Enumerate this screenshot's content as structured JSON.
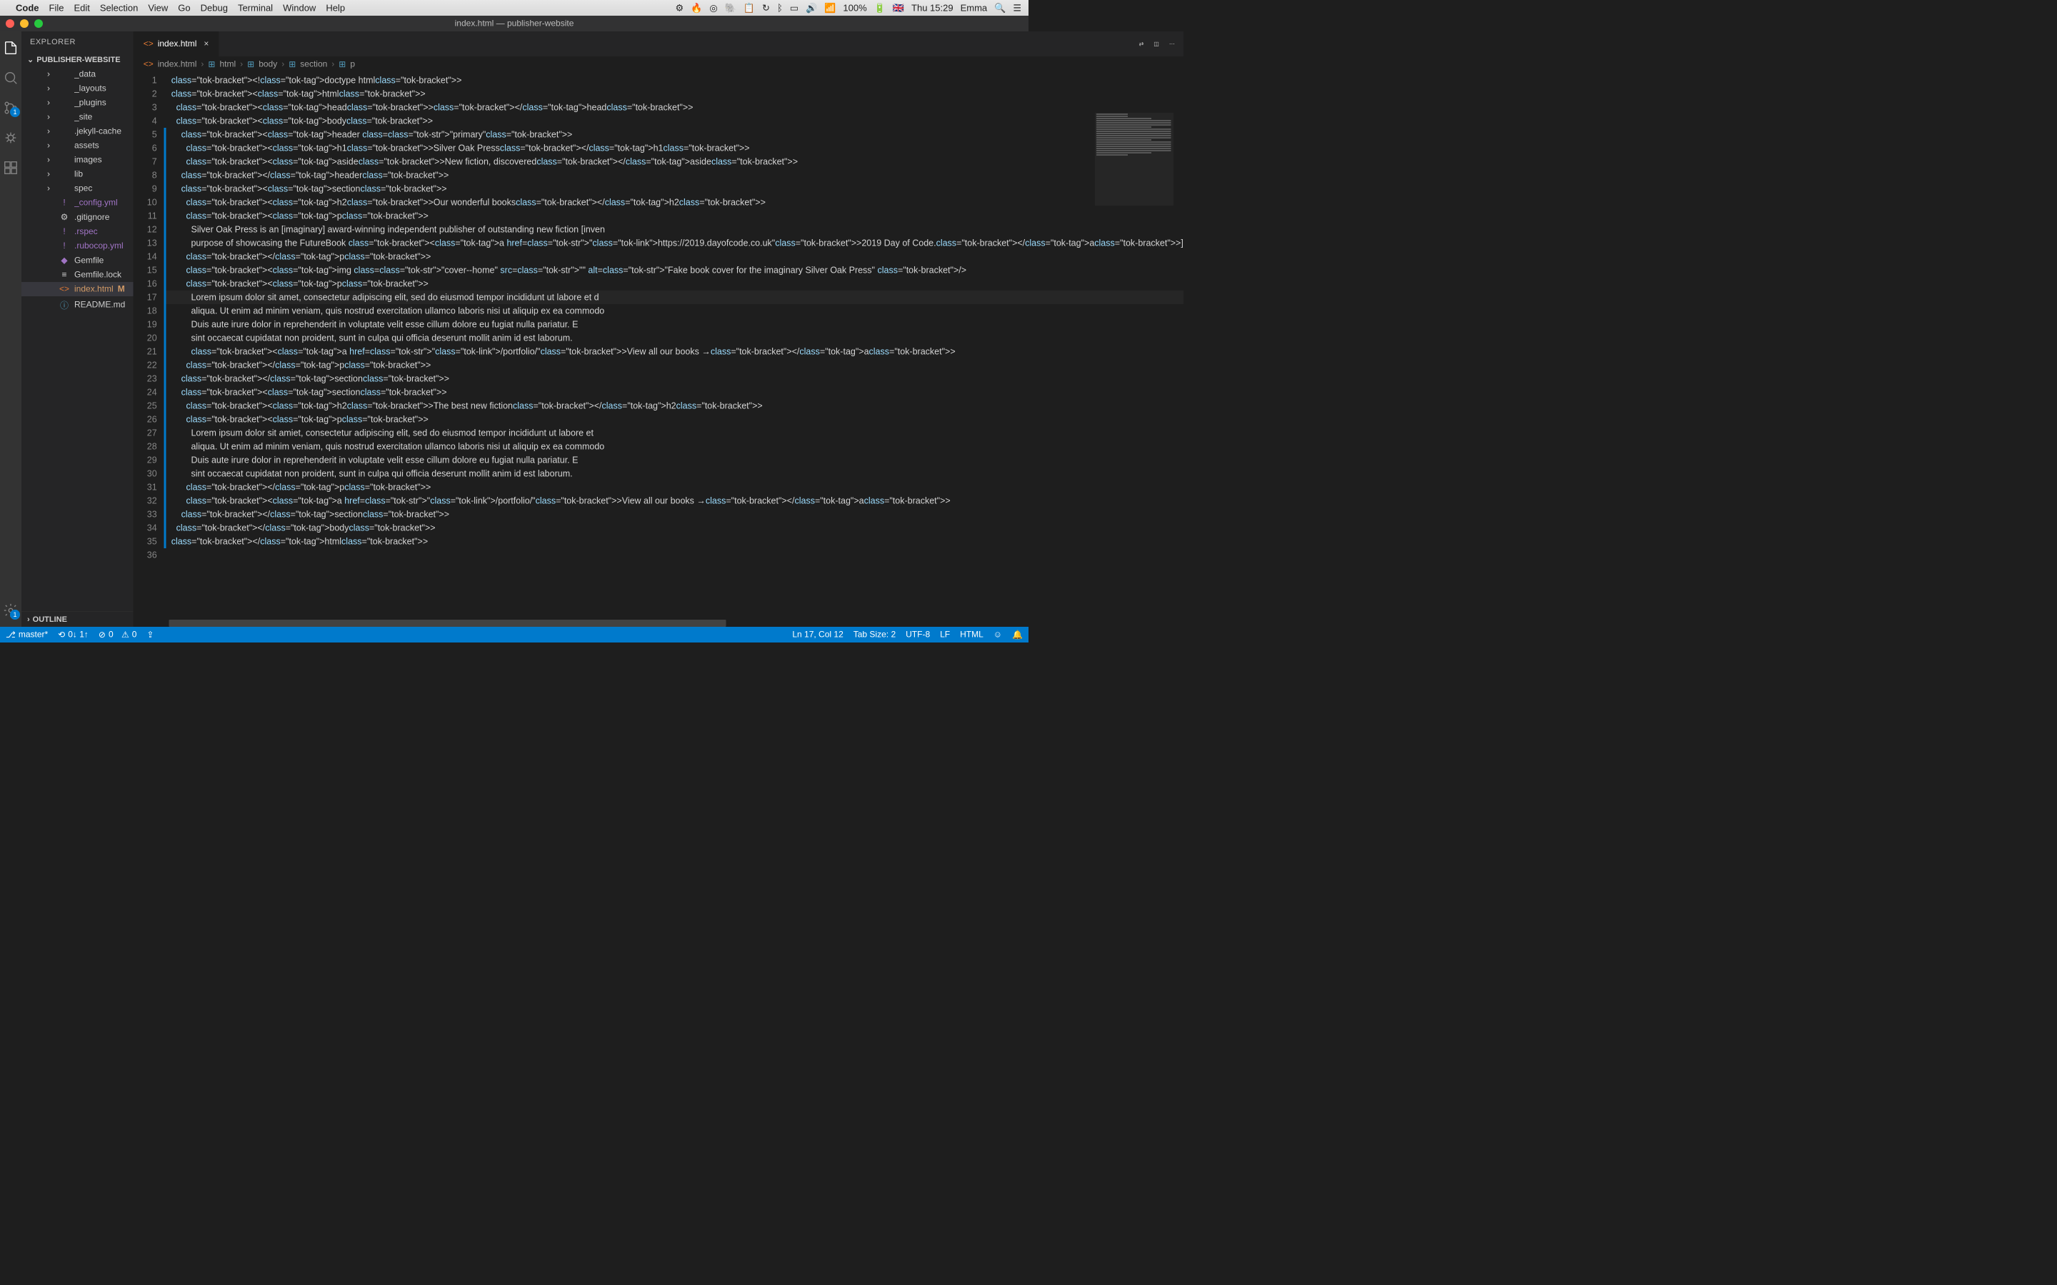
{
  "menubar": {
    "app": "Code",
    "items": [
      "File",
      "Edit",
      "Selection",
      "View",
      "Go",
      "Debug",
      "Terminal",
      "Window",
      "Help"
    ],
    "battery": "100%",
    "clock": "Thu 15:29",
    "user": "Emma",
    "flag": "🇬🇧"
  },
  "window": {
    "title": "index.html — publisher-website"
  },
  "activity": {
    "scm_badge": "1",
    "gear_badge": "1"
  },
  "sidebar": {
    "title": "EXPLORER",
    "project": "PUBLISHER-WEBSITE",
    "outline": "OUTLINE",
    "items": [
      {
        "type": "folder",
        "label": "_data"
      },
      {
        "type": "folder",
        "label": "_layouts"
      },
      {
        "type": "folder",
        "label": "_plugins"
      },
      {
        "type": "folder",
        "label": "_site"
      },
      {
        "type": "folder",
        "label": ".jekyll-cache"
      },
      {
        "type": "folder",
        "label": "assets"
      },
      {
        "type": "folder",
        "label": "images"
      },
      {
        "type": "folder",
        "label": "lib"
      },
      {
        "type": "folder",
        "label": "spec"
      },
      {
        "type": "yml",
        "label": "_config.yml",
        "icon": "!"
      },
      {
        "type": "file",
        "label": ".gitignore",
        "icon": "⚙"
      },
      {
        "type": "yml",
        "label": ".rspec",
        "icon": "!"
      },
      {
        "type": "yml",
        "label": ".rubocop.yml",
        "icon": "!"
      },
      {
        "type": "ruby",
        "label": "Gemfile",
        "icon": "◆"
      },
      {
        "type": "file",
        "label": "Gemfile.lock",
        "icon": "≡"
      },
      {
        "type": "html",
        "label": "index.html",
        "icon": "<>",
        "status": "M",
        "active": true
      },
      {
        "type": "md",
        "label": "README.md",
        "icon": "ⓘ"
      }
    ]
  },
  "tabs": {
    "active": {
      "icon": "<>",
      "label": "index.html"
    }
  },
  "breadcrumb": [
    {
      "icon": "<>",
      "label": "index.html",
      "kind": "file"
    },
    {
      "icon": "⊞",
      "label": "html",
      "kind": "tag"
    },
    {
      "icon": "⊞",
      "label": "body",
      "kind": "tag"
    },
    {
      "icon": "⊞",
      "label": "section",
      "kind": "tag"
    },
    {
      "icon": "⊞",
      "label": "p",
      "kind": "tag"
    }
  ],
  "code": {
    "lines": [
      {
        "n": 1,
        "t": "<!doctype html>"
      },
      {
        "n": 2,
        "t": "<html>"
      },
      {
        "n": 3,
        "t": "  <head></head>"
      },
      {
        "n": 4,
        "t": "  <body>"
      },
      {
        "n": 5,
        "t": "    <header class=\"primary\">"
      },
      {
        "n": 6,
        "t": "      <h1>Silver Oak Press</h1>"
      },
      {
        "n": 7,
        "t": "      <aside>New fiction, discovered</aside>"
      },
      {
        "n": 8,
        "t": "    </header>"
      },
      {
        "n": 9,
        "t": "    <section>"
      },
      {
        "n": 10,
        "t": "      <h2>Our wonderful books</h2>"
      },
      {
        "n": 11,
        "t": "      <p>"
      },
      {
        "n": 12,
        "t": "        Silver Oak Press is an [imaginary] award-winning independent publisher of outstanding new fiction [inven"
      },
      {
        "n": 13,
        "t": "        purpose of showcasing the FutureBook <a href=\"https://2019.dayofcode.co.uk\">2019 Day of Code.</a>]"
      },
      {
        "n": 14,
        "t": "      </p>"
      },
      {
        "n": 15,
        "t": "      <img class=\"cover--home\" src=\"\" alt=\"Fake book cover for the imaginary Silver Oak Press\" />"
      },
      {
        "n": 16,
        "t": "      <p>"
      },
      {
        "n": 17,
        "t": "        Lorem ipsum dolor sit amet, consectetur adipiscing elit, sed do eiusmod tempor incididunt ut labore et d"
      },
      {
        "n": 18,
        "t": "        aliqua. Ut enim ad minim veniam, quis nostrud exercitation ullamco laboris nisi ut aliquip ex ea commodo"
      },
      {
        "n": 19,
        "t": "        Duis aute irure dolor in reprehenderit in voluptate velit esse cillum dolore eu fugiat nulla pariatur. E"
      },
      {
        "n": 20,
        "t": "        sint occaecat cupidatat non proident, sunt in culpa qui officia deserunt mollit anim id est laborum."
      },
      {
        "n": 21,
        "t": "        <a href=\"/portfolio/\">View all our books →</a>"
      },
      {
        "n": 22,
        "t": "      </p>"
      },
      {
        "n": 23,
        "t": "    </section>"
      },
      {
        "n": 24,
        "t": "    <section>"
      },
      {
        "n": 25,
        "t": "      <h2>The best new fiction</h2>"
      },
      {
        "n": 26,
        "t": "      <p>"
      },
      {
        "n": 27,
        "t": "        Lorem ipsum dolor sit amiet, consectetur adipiscing elit, sed do eiusmod tempor incididunt ut labore et"
      },
      {
        "n": 28,
        "t": "        aliqua. Ut enim ad minim veniam, quis nostrud exercitation ullamco laboris nisi ut aliquip ex ea commodo"
      },
      {
        "n": 29,
        "t": "        Duis aute irure dolor in reprehenderit in voluptate velit esse cillum dolore eu fugiat nulla pariatur. E"
      },
      {
        "n": 30,
        "t": "        sint occaecat cupidatat non proident, sunt in culpa qui officia deserunt mollit anim id est laborum."
      },
      {
        "n": 31,
        "t": "      </p>"
      },
      {
        "n": 32,
        "t": "      <a href=\"/portfolio/\">View all our books →</a>"
      },
      {
        "n": 33,
        "t": "    </section>"
      },
      {
        "n": 34,
        "t": "  </body>"
      },
      {
        "n": 35,
        "t": "</html>"
      },
      {
        "n": 36,
        "t": ""
      }
    ],
    "modified_start": 5,
    "modified_end": 35,
    "active_line": 17
  },
  "status": {
    "branch": "master*",
    "sync": "0↓ 1↑",
    "errors": "0",
    "warnings": "0",
    "cursor": "Ln 17, Col 12",
    "tabsize": "Tab Size: 2",
    "encoding": "UTF-8",
    "eol": "LF",
    "lang": "HTML"
  }
}
